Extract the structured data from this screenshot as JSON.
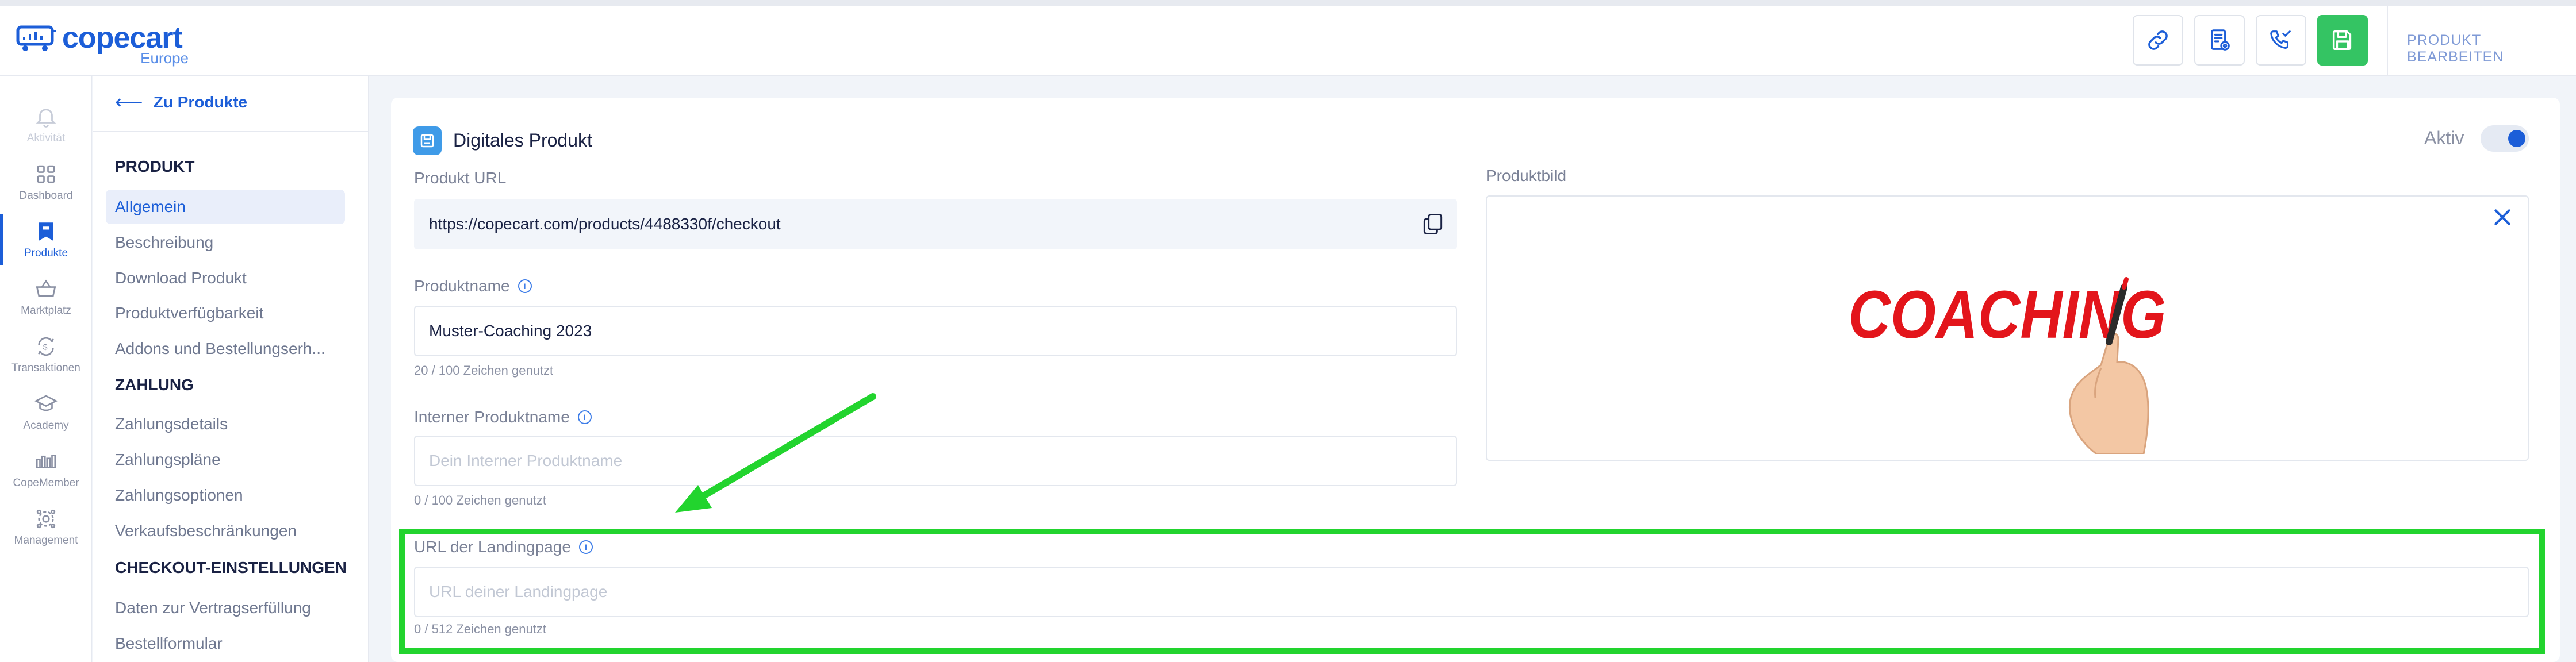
{
  "header": {
    "logo_text": "copecart",
    "logo_sub": "Europe",
    "title": "PRODUKT BEARBEITEN",
    "actions": [
      {
        "icon": "link-icon"
      },
      {
        "icon": "document-settings-icon"
      },
      {
        "icon": "phone-checkout-icon"
      },
      {
        "icon": "save-icon"
      }
    ]
  },
  "rail": {
    "items": [
      {
        "label": "Aktivität",
        "icon": "bell-icon"
      },
      {
        "label": "Dashboard",
        "icon": "dashboard-icon"
      },
      {
        "label": "Produkte",
        "icon": "bookmark-icon"
      },
      {
        "label": "Marktplatz",
        "icon": "basket-icon"
      },
      {
        "label": "Transaktionen",
        "icon": "transactions-icon"
      },
      {
        "label": "Academy",
        "icon": "graduation-cap-icon"
      },
      {
        "label": "CopeMember",
        "icon": "community-icon"
      },
      {
        "label": "Management",
        "icon": "management-gear-icon"
      }
    ]
  },
  "sidebar": {
    "back_label": "Zu Produkte",
    "sections": [
      {
        "heading": "PRODUKT",
        "items": [
          "Allgemein",
          "Beschreibung",
          "Download Produkt",
          "Produktverfügbarkeit",
          "Addons und Bestellungserh..."
        ]
      },
      {
        "heading": "ZAHLUNG",
        "items": [
          "Zahlungsdetails",
          "Zahlungspläne",
          "Zahlungsoptionen",
          "Verkaufsbeschränkungen"
        ]
      },
      {
        "heading": "CHECKOUT-EINSTELLUNGEN",
        "items": [
          "Daten zur Vertragserfüllung",
          "Bestellformular"
        ]
      }
    ],
    "active_item": "Allgemein"
  },
  "card": {
    "title": "Digitales Produkt",
    "status_label": "Aktiv",
    "status_on": true
  },
  "form": {
    "product_url": {
      "label": "Produkt URL",
      "value": "https://copecart.com/products/4488330f/checkout"
    },
    "product_name": {
      "label": "Produktname",
      "value": "Muster-Coaching 2023",
      "hint": "20 / 100 Zeichen genutzt"
    },
    "internal_name": {
      "label": "Interner Produktname",
      "placeholder": "Dein Interner Produktname",
      "hint": "0 / 100 Zeichen genutzt"
    },
    "landing_url": {
      "label": "URL der Landingpage",
      "placeholder": "URL deiner Landingpage",
      "hint": "0 / 512 Zeichen genutzt"
    },
    "product_image": {
      "label": "Produktbild",
      "image_text": "COACHING"
    }
  },
  "colors": {
    "brand": "#1c5ed8",
    "save_green": "#34c463",
    "highlight_green": "#22d42e",
    "coaching_red": "#e3151b"
  }
}
